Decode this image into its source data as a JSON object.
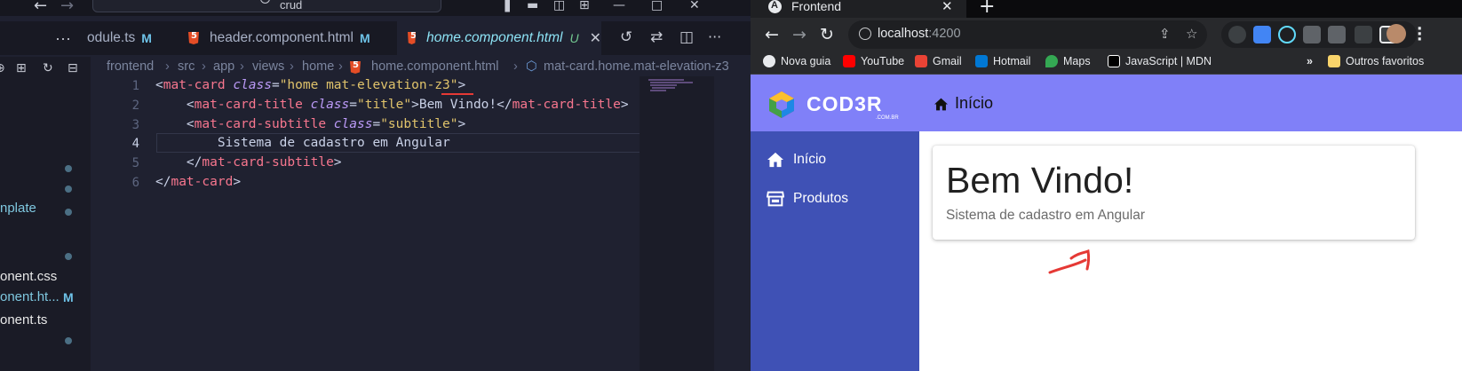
{
  "vscode": {
    "search_text": "crud",
    "tabs": [
      {
        "label": "odule.ts",
        "badge": "M"
      },
      {
        "label": "header.component.html",
        "badge": "M"
      },
      {
        "label": "home.component.html",
        "badge": "U",
        "active": true
      }
    ],
    "breadcrumb": [
      "frontend",
      "src",
      "app",
      "views",
      "home",
      "home.component.html",
      "mat-card.home.mat-elevation-z3"
    ],
    "sidebar_items": [
      {
        "label": "nplate",
        "color": "#7fc8e0"
      },
      {
        "label": "onent.css",
        "color": "#e8e8e8"
      },
      {
        "label": "onent.ht...",
        "color": "#7fc8e0",
        "badge": "M"
      },
      {
        "label": "onent.ts",
        "color": "#e8e8e8"
      }
    ],
    "line_numbers": [
      "1",
      "2",
      "3",
      "4",
      "5",
      "6"
    ],
    "code": {
      "l1_open": "<",
      "l1_tag": "mat-card",
      "l1_attr": "class",
      "l1_eq": "=",
      "l1_val": "\"home mat-elevation-z3\"",
      "l1_close": ">",
      "l2_tag": "mat-card-title",
      "l2_attr": "class",
      "l2_val": "\"title\"",
      "l2_text": "Bem Vindo!",
      "l2_endtag": "mat-card-title",
      "l3_tag": "mat-card-subtitle",
      "l3_attr": "class",
      "l3_val": "\"subtitle\"",
      "l4_text": "Sistema de cadastro em Angular",
      "l5_endtag": "mat-card-subtitle",
      "l6_endtag": "mat-card"
    }
  },
  "chrome": {
    "tab_title": "Frontend",
    "url_host": "localhost",
    "url_port": ":4200",
    "bookmarks": [
      {
        "label": "Nova guia",
        "color": "#e8eaed"
      },
      {
        "label": "YouTube",
        "color": "#ff0000"
      },
      {
        "label": "Gmail",
        "color": "#ea4335"
      },
      {
        "label": "Hotmail",
        "color": "#0078d4"
      },
      {
        "label": "Maps",
        "color": "#34a853"
      },
      {
        "label": "JavaScript | MDN",
        "color": "#ffffff"
      }
    ],
    "other_bookmarks": "Outros favoritos"
  },
  "app": {
    "logo_text": "COD3R",
    "logo_sub": ".COM.BR",
    "header_title": "Início",
    "nav": [
      {
        "label": "Início",
        "icon": "home-icon"
      },
      {
        "label": "Produtos",
        "icon": "store-icon"
      }
    ],
    "card_title": "Bem Vindo!",
    "card_subtitle": "Sistema de cadastro em Angular",
    "header_color": "#8080f8",
    "nav_color": "#3f51b5"
  }
}
